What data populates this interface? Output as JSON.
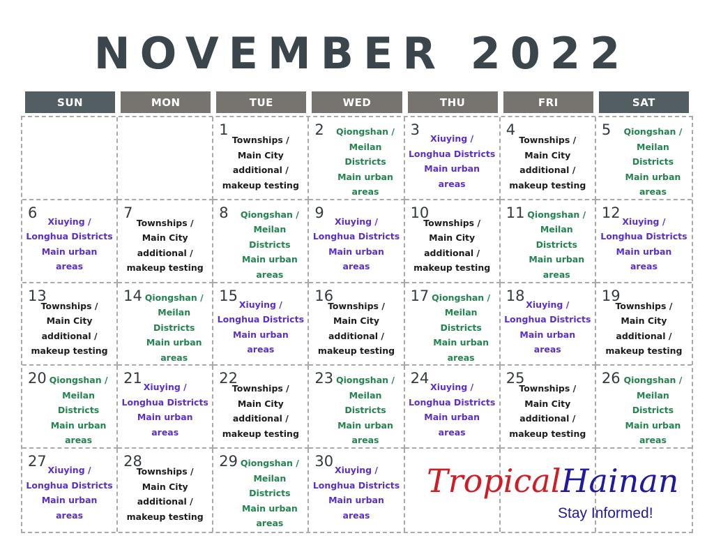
{
  "title": "NOVEMBER 2022",
  "weekdays": [
    "SUN",
    "MON",
    "TUE",
    "WED",
    "THU",
    "FRI",
    "SAT"
  ],
  "colors": {
    "header_weekday": "#77736e",
    "header_weekend": "#535e62",
    "townships": "#1d1d1d",
    "qiongshan": "#238450",
    "xiuying": "#5b2fc9",
    "logo_red": "#cf1d25",
    "logo_blue": "#1f1aa0"
  },
  "note_types": {
    "townships": "Townships /\nMain City\nadditional /\nmakeup testing",
    "qiongshan": "Qiongshan /\nMeilan\nDistricts\nMain urban\nareas",
    "xiuying": "Xiuying /\nLonghua  Districts\nMain urban\nareas"
  },
  "days": [
    {
      "day": "",
      "type": ""
    },
    {
      "day": "",
      "type": ""
    },
    {
      "day": "1",
      "type": "townships"
    },
    {
      "day": "2",
      "type": "qiongshan"
    },
    {
      "day": "3",
      "type": "xiuying"
    },
    {
      "day": "4",
      "type": "townships"
    },
    {
      "day": "5",
      "type": "qiongshan"
    },
    {
      "day": "6",
      "type": "xiuying"
    },
    {
      "day": "7",
      "type": "townships"
    },
    {
      "day": "8",
      "type": "qiongshan"
    },
    {
      "day": "9",
      "type": "xiuying"
    },
    {
      "day": "10",
      "type": "townships"
    },
    {
      "day": "11",
      "type": "qiongshan"
    },
    {
      "day": "12",
      "type": "xiuying"
    },
    {
      "day": "13",
      "type": "townships"
    },
    {
      "day": "14",
      "type": "qiongshan"
    },
    {
      "day": "15",
      "type": "xiuying"
    },
    {
      "day": "16",
      "type": "townships"
    },
    {
      "day": "17",
      "type": "qiongshan"
    },
    {
      "day": "18",
      "type": "xiuying"
    },
    {
      "day": "19",
      "type": "townships"
    },
    {
      "day": "20",
      "type": "qiongshan"
    },
    {
      "day": "21",
      "type": "xiuying"
    },
    {
      "day": "22",
      "type": "townships"
    },
    {
      "day": "23",
      "type": "qiongshan"
    },
    {
      "day": "24",
      "type": "xiuying"
    },
    {
      "day": "25",
      "type": "townships"
    },
    {
      "day": "26",
      "type": "qiongshan"
    },
    {
      "day": "27",
      "type": "xiuying"
    },
    {
      "day": "28",
      "type": "townships"
    },
    {
      "day": "29",
      "type": "qiongshan"
    },
    {
      "day": "30",
      "type": "xiuying"
    },
    {
      "day": "",
      "type": ""
    },
    {
      "day": "",
      "type": ""
    },
    {
      "day": "",
      "type": ""
    }
  ],
  "logo": {
    "word1": "Tropical",
    "word2": "Hainan",
    "tagline": "Stay Informed!"
  }
}
